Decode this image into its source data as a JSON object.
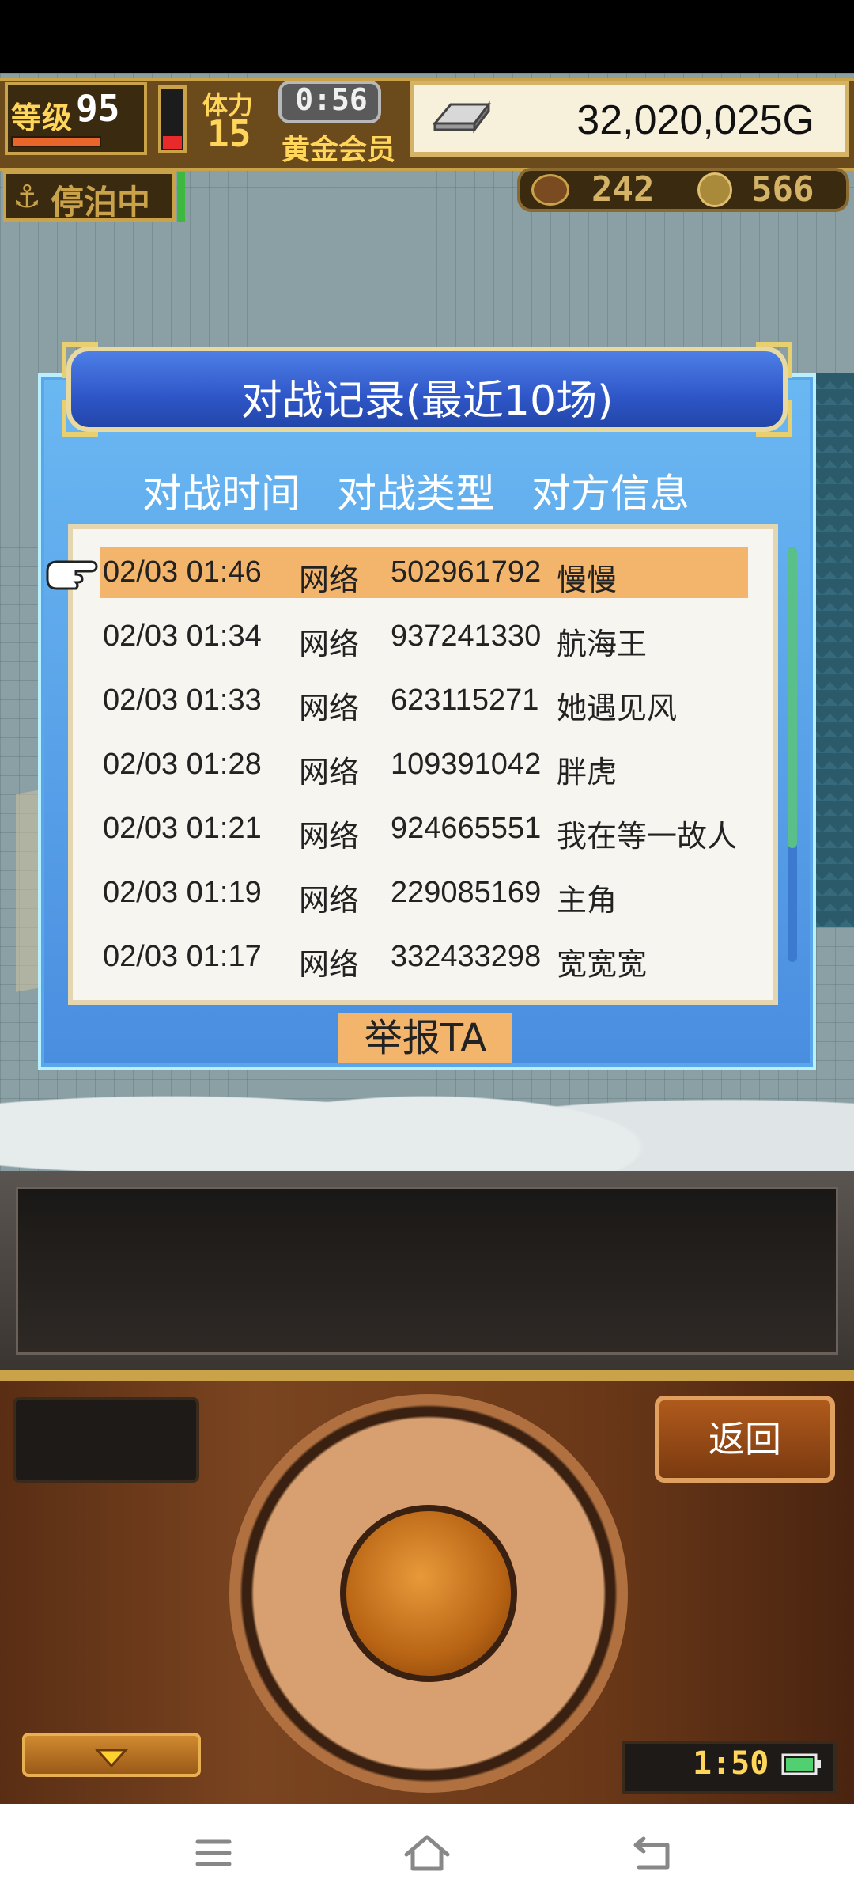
{
  "hud": {
    "level_label": "等级",
    "level_value": "95",
    "stamina_label": "体力",
    "stamina_value": "15",
    "timer": "0:56",
    "membership": "黄金会员",
    "gold": "32,020,025G",
    "status_label": "停泊中",
    "status_icon": "anchor-icon",
    "resource1_value": "242",
    "resource2_value": "566"
  },
  "dialog": {
    "title": "对战记录(最近10场)",
    "columns": [
      "对战时间",
      "对战类型",
      "对方信息"
    ],
    "records": [
      {
        "time": "02/03 01:46",
        "type": "网络",
        "id": "502961792",
        "name": "慢慢",
        "selected": true
      },
      {
        "time": "02/03 01:34",
        "type": "网络",
        "id": "937241330",
        "name": "航海王"
      },
      {
        "time": "02/03 01:33",
        "type": "网络",
        "id": "623115271",
        "name": "她遇见风"
      },
      {
        "time": "02/03 01:28",
        "type": "网络",
        "id": "109391042",
        "name": "胖虎"
      },
      {
        "time": "02/03 01:21",
        "type": "网络",
        "id": "924665551",
        "name": "我在等一故人"
      },
      {
        "time": "02/03 01:19",
        "type": "网络",
        "id": "229085169",
        "name": "主角"
      },
      {
        "time": "02/03 01:17",
        "type": "网络",
        "id": "332433298",
        "name": "宽宽宽"
      }
    ],
    "report_label": "举报TA"
  },
  "controller": {
    "back_label": "返回",
    "clock": "1:50"
  },
  "colors": {
    "dialog_bg": "#5aa6ea",
    "title_bar": "#2f56c8",
    "selected_row": "#f3b56c",
    "gold_text": "#ffd65a"
  }
}
